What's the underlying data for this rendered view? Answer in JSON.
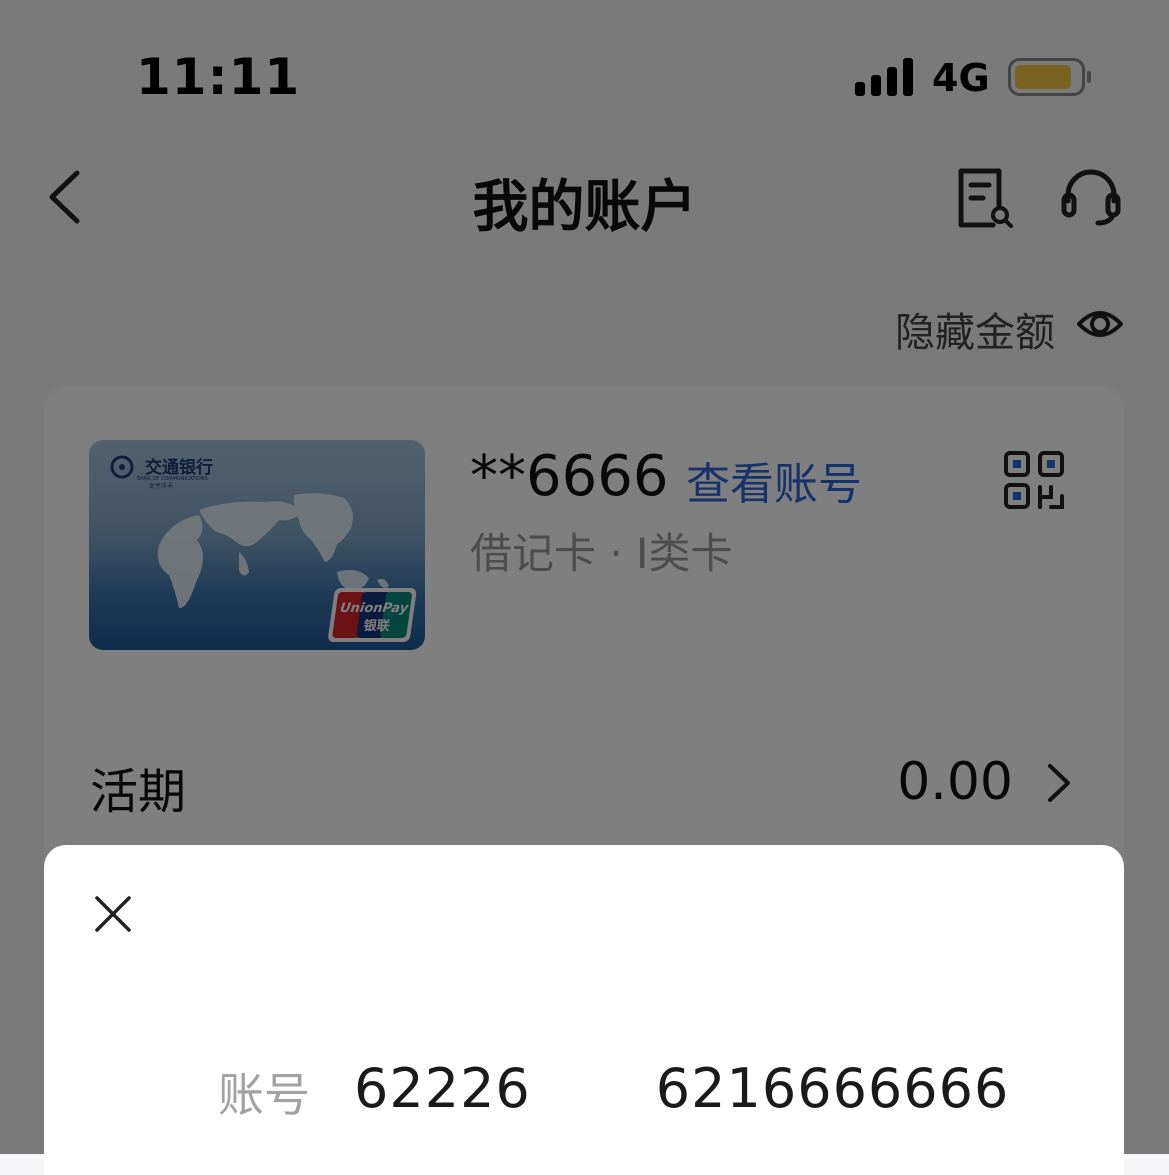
{
  "status_bar": {
    "time": "11:11",
    "network": "4G",
    "battery_color": "#f4c542"
  },
  "nav": {
    "title": "我的账户",
    "icons": [
      "back-arrow-icon",
      "bill-search-icon",
      "customer-service-icon"
    ]
  },
  "hide_amount": {
    "label": "隐藏金额",
    "icon": "eye-icon"
  },
  "card": {
    "bank_name_cn": "交通银行",
    "bank_name_en": "BANK OF COMMUNICATIONS",
    "bank_sub": "太平洋卡",
    "unionpay_en": "UnionPay",
    "unionpay_cn": "银联",
    "masked_number": "**6666",
    "view_account_label": "查看账号",
    "type_label": "借记卡 · I类卡",
    "qr_icon": "qr-code-icon"
  },
  "current_deposit": {
    "label": "活期",
    "value": "0.00"
  },
  "sheet": {
    "account_label": "账号",
    "account_prefix": "62226",
    "account_suffix": "6216666666"
  },
  "colors": {
    "accent_blue": "#2e66d6",
    "overlay": "rgba(0,0,0,0.5)"
  }
}
